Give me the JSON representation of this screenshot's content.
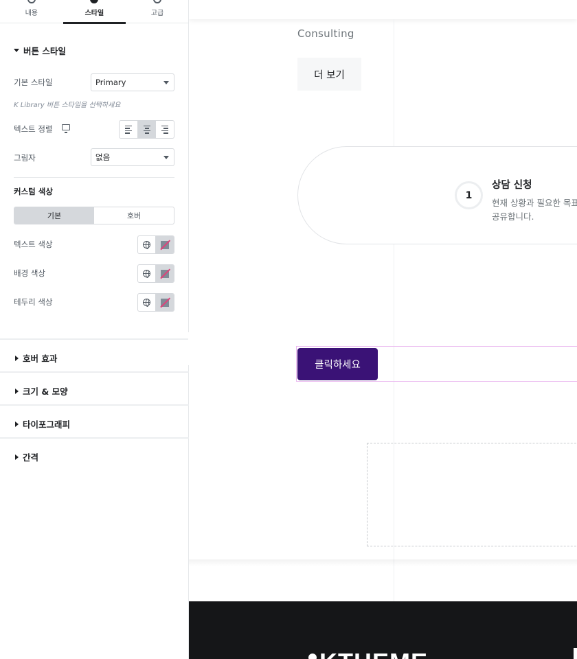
{
  "panel": {
    "tabs": [
      {
        "label": "내용",
        "icon": "pencil-icon"
      },
      {
        "label": "스타일",
        "icon": "style-icon"
      },
      {
        "label": "고급",
        "icon": "gear-icon"
      }
    ],
    "button_style": {
      "title": "버튼 스타일",
      "base_style_label": "기본 스타일",
      "base_style_value": "Primary",
      "hint": "K Library 버튼 스타일을 선택하세요",
      "text_align_label": "텍스트 정렬",
      "shadow_label": "그림자",
      "shadow_value": "없음"
    },
    "custom_color": {
      "title": "커스텀 색상",
      "tabs": [
        "기본",
        "호버"
      ],
      "text_color_label": "텍스트 색상",
      "bg_color_label": "배경 색상",
      "border_color_label": "테두리 색상"
    },
    "sections": [
      "호버 효과",
      "크기 & 모양",
      "타이포그래피",
      "간격"
    ]
  },
  "canvas": {
    "subtitle": "Consulting",
    "more_button": "더 보기",
    "step": {
      "number": "1",
      "title": "상담 신청",
      "desc_line1": "현재 상황과 필요한 목표",
      "desc_line2": "공유합니다."
    },
    "cta_button": "클릭하세요",
    "footer_logo": "KTHEME",
    "colors": {
      "cta_bg": "#3a1276",
      "footer_bg": "#151618",
      "selection_outline": "#e9b6ef"
    }
  }
}
